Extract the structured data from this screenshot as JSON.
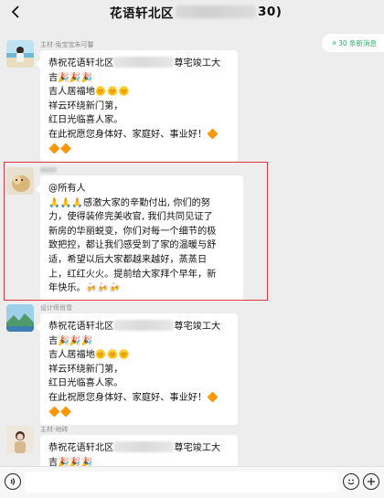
{
  "header": {
    "title_prefix": "花语轩北区",
    "title_suffix": "30)"
  },
  "new_messages_badge": {
    "arrow": "«",
    "label": "30 条新消息"
  },
  "messages": [
    {
      "sender": "主材-兔宝宝朱可馨",
      "avatar_icon": "beach-person-avatar",
      "lines_before": "恭祝花语轩北区",
      "lines_after": "尊宅竣工大",
      "body": [
        "吉🎉🎉🎉",
        "吉人居福地🌞🌞🌞",
        "祥云环绕新门第，",
        "红日光临喜人家。",
        "在此祝愿您身体好、家庭好、事业好！🔶",
        "🔶🔶"
      ]
    },
    {
      "sender": "",
      "avatar_icon": "dog-avatar",
      "body": [
        "@所有人",
        "🙏🙏🙏感激大家的辛勤付出, 你们的努",
        "力，使得装修完美收官, 我们共同见证了",
        "新房的华丽蜕变，你们对每一个细节的极",
        "致把控，都让我们感受到了家的温暖与舒",
        "适，希望以后大家都越来越好，蒸蒸日",
        "上，红红火火。提前给大家拜个早年，新",
        "年快乐。🍻🍻🍻"
      ]
    },
    {
      "sender": "设计师肖雪",
      "avatar_icon": "landscape-avatar",
      "lines_before": "恭祝花语轩北区",
      "lines_after": "尊宅竣工大",
      "body": [
        "吉🎉🎉🎉",
        "吉人居福地🌞🌞🌞",
        "祥云环绕新门第，",
        "红日光临喜人家。",
        "在此祝愿您身体好、家庭好、事业好！🔶",
        "🔶🔶"
      ]
    },
    {
      "sender": "主材-地砖",
      "avatar_icon": "woman-avatar",
      "lines_before": "恭祝花语轩北区",
      "lines_after": "尊宅竣工大",
      "body": [
        "吉🎉🎉🎉"
      ]
    }
  ],
  "input": {
    "placeholder": ""
  },
  "colors": {
    "accent_green": "#2aae67",
    "highlight_red": "#d9363e",
    "background": "#ededed"
  }
}
